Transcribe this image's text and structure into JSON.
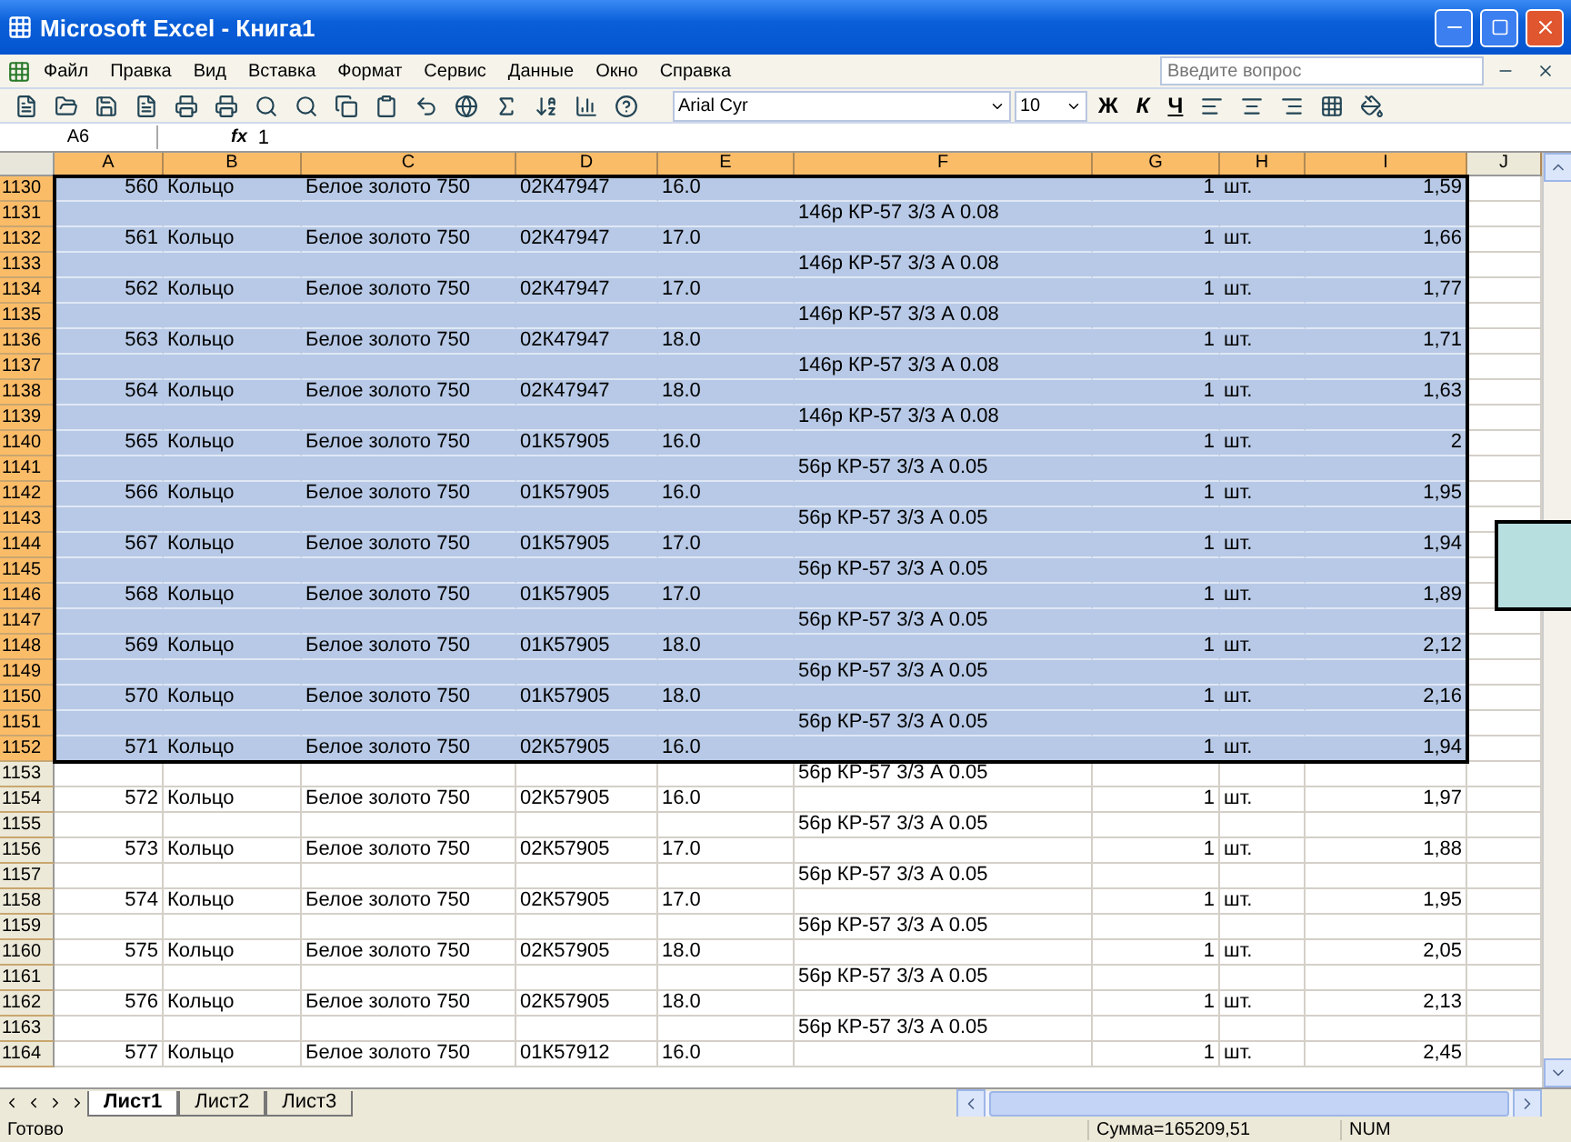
{
  "window": {
    "title": "Microsoft Excel - Книга1"
  },
  "menu": [
    "Файл",
    "Правка",
    "Вид",
    "Вставка",
    "Формат",
    "Сервис",
    "Данные",
    "Окно",
    "Справка"
  ],
  "help": {
    "placeholder": "Введите вопрос"
  },
  "format": {
    "font": "Arial Cyr",
    "size": "10",
    "bold": "Ж",
    "italic": "К",
    "underline": "Ч"
  },
  "formula_bar": {
    "name_box": "A6",
    "fx": "fx",
    "value": "1"
  },
  "columns": [
    {
      "label": "A",
      "selected": true
    },
    {
      "label": "B",
      "selected": true
    },
    {
      "label": "C",
      "selected": true
    },
    {
      "label": "D",
      "selected": true
    },
    {
      "label": "E",
      "selected": true
    },
    {
      "label": "F",
      "selected": true
    },
    {
      "label": "G",
      "selected": true
    },
    {
      "label": "H",
      "selected": true
    },
    {
      "label": "I",
      "selected": true
    },
    {
      "label": "J",
      "selected": false
    }
  ],
  "rows": [
    {
      "number": "1130",
      "selected": true,
      "cells": [
        "560",
        "Кольцо",
        "Белое золото 750",
        "02К47947",
        "16.0",
        null,
        "1",
        "шт.",
        "1,59"
      ]
    },
    {
      "number": "1131",
      "selected": true,
      "cells": [
        null,
        null,
        null,
        null,
        null,
        "146р КР-57 3/3 А 0.08",
        null,
        null,
        null
      ]
    },
    {
      "number": "1132",
      "selected": true,
      "cells": [
        "561",
        "Кольцо",
        "Белое золото 750",
        "02К47947",
        "17.0",
        null,
        "1",
        "шт.",
        "1,66"
      ]
    },
    {
      "number": "1133",
      "selected": true,
      "cells": [
        null,
        null,
        null,
        null,
        null,
        "146р КР-57 3/3 А 0.08",
        null,
        null,
        null
      ]
    },
    {
      "number": "1134",
      "selected": true,
      "cells": [
        "562",
        "Кольцо",
        "Белое золото 750",
        "02К47947",
        "17.0",
        null,
        "1",
        "шт.",
        "1,77"
      ]
    },
    {
      "number": "1135",
      "selected": true,
      "cells": [
        null,
        null,
        null,
        null,
        null,
        "146р КР-57 3/3 А 0.08",
        null,
        null,
        null
      ]
    },
    {
      "number": "1136",
      "selected": true,
      "cells": [
        "563",
        "Кольцо",
        "Белое золото 750",
        "02К47947",
        "18.0",
        null,
        "1",
        "шт.",
        "1,71"
      ]
    },
    {
      "number": "1137",
      "selected": true,
      "cells": [
        null,
        null,
        null,
        null,
        null,
        "146р КР-57 3/3 А 0.08",
        null,
        null,
        null
      ]
    },
    {
      "number": "1138",
      "selected": true,
      "cells": [
        "564",
        "Кольцо",
        "Белое золото 750",
        "02К47947",
        "18.0",
        null,
        "1",
        "шт.",
        "1,63"
      ]
    },
    {
      "number": "1139",
      "selected": true,
      "cells": [
        null,
        null,
        null,
        null,
        null,
        "146р КР-57 3/3 А 0.08",
        null,
        null,
        null
      ]
    },
    {
      "number": "1140",
      "selected": true,
      "cells": [
        "565",
        "Кольцо",
        "Белое золото 750",
        "01К57905",
        "16.0",
        null,
        "1",
        "шт.",
        "2"
      ]
    },
    {
      "number": "1141",
      "selected": true,
      "cells": [
        null,
        null,
        null,
        null,
        null,
        "56р КР-57 3/3 А 0.05",
        null,
        null,
        null
      ]
    },
    {
      "number": "1142",
      "selected": true,
      "cells": [
        "566",
        "Кольцо",
        "Белое золото 750",
        "01К57905",
        "16.0",
        null,
        "1",
        "шт.",
        "1,95"
      ]
    },
    {
      "number": "1143",
      "selected": true,
      "cells": [
        null,
        null,
        null,
        null,
        null,
        "56р КР-57 3/3 А 0.05",
        null,
        null,
        null
      ]
    },
    {
      "number": "1144",
      "selected": true,
      "cells": [
        "567",
        "Кольцо",
        "Белое золото 750",
        "01К57905",
        "17.0",
        null,
        "1",
        "шт.",
        "1,94"
      ]
    },
    {
      "number": "1145",
      "selected": true,
      "cells": [
        null,
        null,
        null,
        null,
        null,
        "56р КР-57 3/3 А 0.05",
        null,
        null,
        null
      ]
    },
    {
      "number": "1146",
      "selected": true,
      "cells": [
        "568",
        "Кольцо",
        "Белое золото 750",
        "01К57905",
        "17.0",
        null,
        "1",
        "шт.",
        "1,89"
      ]
    },
    {
      "number": "1147",
      "selected": true,
      "cells": [
        null,
        null,
        null,
        null,
        null,
        "56р КР-57 3/3 А 0.05",
        null,
        null,
        null
      ]
    },
    {
      "number": "1148",
      "selected": true,
      "cells": [
        "569",
        "Кольцо",
        "Белое золото 750",
        "01К57905",
        "18.0",
        null,
        "1",
        "шт.",
        "2,12"
      ]
    },
    {
      "number": "1149",
      "selected": true,
      "cells": [
        null,
        null,
        null,
        null,
        null,
        "56р КР-57 3/3 А 0.05",
        null,
        null,
        null
      ]
    },
    {
      "number": "1150",
      "selected": true,
      "cells": [
        "570",
        "Кольцо",
        "Белое золото 750",
        "01К57905",
        "18.0",
        null,
        "1",
        "шт.",
        "2,16"
      ]
    },
    {
      "number": "1151",
      "selected": true,
      "cells": [
        null,
        null,
        null,
        null,
        null,
        "56р КР-57 3/3 А 0.05",
        null,
        null,
        null
      ]
    },
    {
      "number": "1152",
      "selected": true,
      "cells": [
        "571",
        "Кольцо",
        "Белое золото 750",
        "02К57905",
        "16.0",
        null,
        "1",
        "шт.",
        "1,94"
      ]
    },
    {
      "number": "1153",
      "selected": false,
      "cells": [
        null,
        null,
        null,
        null,
        null,
        "56р КР-57 3/3 А 0.05",
        null,
        null,
        null
      ]
    },
    {
      "number": "1154",
      "selected": false,
      "cells": [
        "572",
        "Кольцо",
        "Белое золото 750",
        "02К57905",
        "16.0",
        null,
        "1",
        "шт.",
        "1,97"
      ]
    },
    {
      "number": "1155",
      "selected": false,
      "cells": [
        null,
        null,
        null,
        null,
        null,
        "56р КР-57 3/3 А 0.05",
        null,
        null,
        null
      ]
    },
    {
      "number": "1156",
      "selected": false,
      "cells": [
        "573",
        "Кольцо",
        "Белое золото 750",
        "02К57905",
        "17.0",
        null,
        "1",
        "шт.",
        "1,88"
      ]
    },
    {
      "number": "1157",
      "selected": false,
      "cells": [
        null,
        null,
        null,
        null,
        null,
        "56р КР-57 3/3 А 0.05",
        null,
        null,
        null
      ]
    },
    {
      "number": "1158",
      "selected": false,
      "cells": [
        "574",
        "Кольцо",
        "Белое золото 750",
        "02К57905",
        "17.0",
        null,
        "1",
        "шт.",
        "1,95"
      ]
    },
    {
      "number": "1159",
      "selected": false,
      "cells": [
        null,
        null,
        null,
        null,
        null,
        "56р КР-57 3/3 А 0.05",
        null,
        null,
        null
      ]
    },
    {
      "number": "1160",
      "selected": false,
      "cells": [
        "575",
        "Кольцо",
        "Белое золото 750",
        "02К57905",
        "18.0",
        null,
        "1",
        "шт.",
        "2,05"
      ]
    },
    {
      "number": "1161",
      "selected": false,
      "cells": [
        null,
        null,
        null,
        null,
        null,
        "56р КР-57 3/3 А 0.05",
        null,
        null,
        null
      ]
    },
    {
      "number": "1162",
      "selected": false,
      "cells": [
        "576",
        "Кольцо",
        "Белое золото 750",
        "02К57905",
        "18.0",
        null,
        "1",
        "шт.",
        "2,13"
      ]
    },
    {
      "number": "1163",
      "selected": false,
      "cells": [
        null,
        null,
        null,
        null,
        null,
        "56р КР-57 3/3 А 0.05",
        null,
        null,
        null
      ]
    },
    {
      "number": "1164",
      "selected": false,
      "cells": [
        "577",
        "Кольцо",
        "Белое золото 750",
        "01К57912",
        "16.0",
        null,
        "1",
        "шт.",
        "2,45"
      ]
    }
  ],
  "sheet_tabs": [
    {
      "label": "Лист1",
      "selected": true
    },
    {
      "label": "Лист2",
      "selected": false
    },
    {
      "label": "Лист3",
      "selected": false
    }
  ],
  "status_bar": {
    "state": "Готово",
    "sum": "Сумма=165209,51",
    "num": "NUM"
  }
}
